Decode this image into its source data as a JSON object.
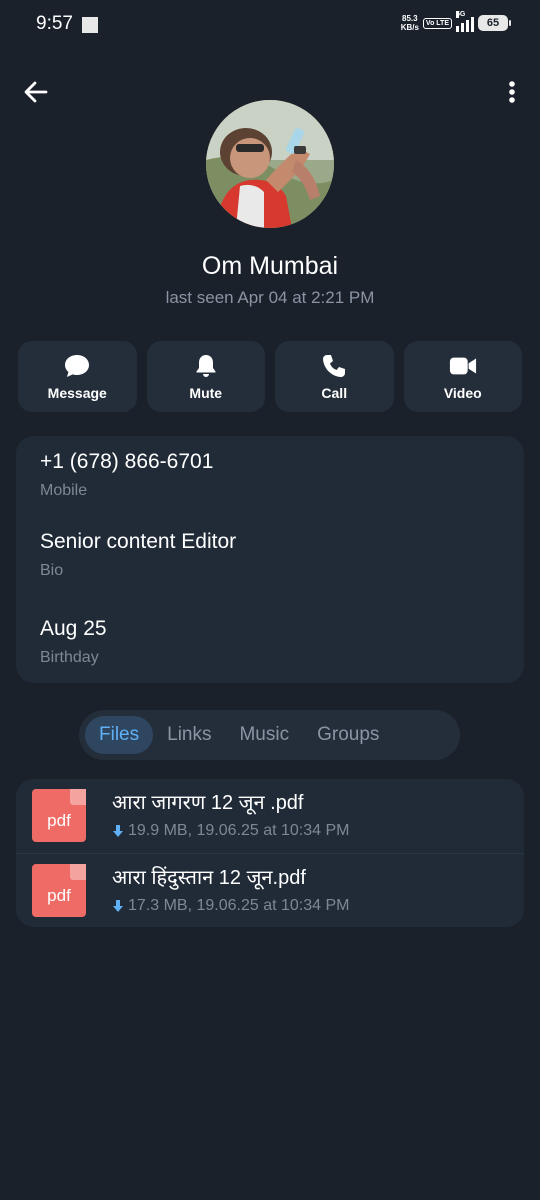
{
  "status": {
    "time": "9:57",
    "net_speed_value": "85.3",
    "net_speed_unit": "KB/s",
    "volte": "Vo LTE",
    "signal_label": "5G",
    "battery": "65"
  },
  "profile": {
    "name": "Om Mumbai",
    "last_seen": "last seen Apr 04 at 2:21 PM"
  },
  "actions": [
    {
      "label": "Message",
      "icon": "chat-bubble-icon"
    },
    {
      "label": "Mute",
      "icon": "bell-icon"
    },
    {
      "label": "Call",
      "icon": "phone-icon"
    },
    {
      "label": "Video",
      "icon": "video-camera-icon"
    }
  ],
  "info": {
    "phone": {
      "value": "+1 (678) 866-6701",
      "label": "Mobile"
    },
    "bio": {
      "value": "Senior content Editor",
      "label": "Bio"
    },
    "birthday": {
      "value": "Aug 25",
      "label": "Birthday"
    }
  },
  "tabs": [
    {
      "label": "Files",
      "active": true
    },
    {
      "label": "Links",
      "active": false
    },
    {
      "label": "Music",
      "active": false
    },
    {
      "label": "Groups",
      "active": false
    }
  ],
  "files": [
    {
      "icon_text": "pdf",
      "name": "आरा जागरण 12 जून .pdf",
      "meta": "19.9 MB, 19.06.25 at 10:34 PM"
    },
    {
      "icon_text": "pdf",
      "name": "आरा हिंदुस्तान 12 जून.pdf",
      "meta": "17.3 MB, 19.06.25 at 10:34 PM"
    }
  ],
  "colors": {
    "background": "#1a212b",
    "card": "#212b37",
    "accent": "#5fb0f5",
    "pdf": "#ef6b65"
  }
}
